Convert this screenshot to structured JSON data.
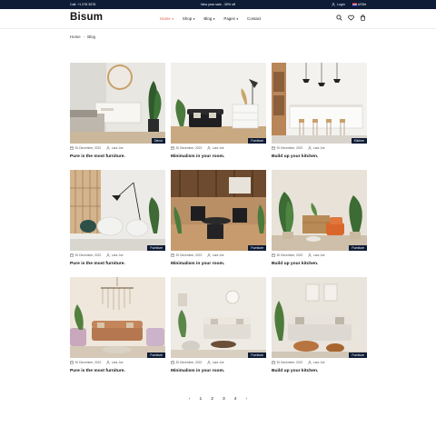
{
  "topbar": {
    "phone": "Call: +1 078 3578",
    "promo": "New year sale - 30% off",
    "login": "Login",
    "currency": "USD"
  },
  "header": {
    "logo": "Bisum",
    "nav": [
      {
        "label": "Home",
        "active": true
      },
      {
        "label": "Shop",
        "active": false
      },
      {
        "label": "Blog",
        "active": false
      },
      {
        "label": "Pages",
        "active": false
      },
      {
        "label": "Contact",
        "active": false
      }
    ],
    "icons": [
      "search-icon",
      "heart-icon",
      "cart-icon"
    ]
  },
  "breadcrumb": {
    "home": "Home",
    "current": "Blog"
  },
  "posts": [
    {
      "tag": "Décor",
      "date": "30 December, 2022",
      "author": "Lara Joe",
      "title": "Pure is the most furniture."
    },
    {
      "tag": "Furniture",
      "date": "30 December, 2022",
      "author": "Lara Joe",
      "title": "Minimalism in your room."
    },
    {
      "tag": "Kitchen",
      "date": "30 December, 2022",
      "author": "Lara Joe",
      "title": "Build up your kitchen."
    },
    {
      "tag": "Furniture",
      "date": "30 December, 2022",
      "author": "Lara Joe",
      "title": "Pure is the most furniture."
    },
    {
      "tag": "Furniture",
      "date": "30 December, 2022",
      "author": "Lara Joe",
      "title": "Minimalism in your room."
    },
    {
      "tag": "Furniture",
      "date": "30 December, 2022",
      "author": "Lara Joe",
      "title": "Build up your kitchen."
    },
    {
      "tag": "Furniture",
      "date": "30 December, 2022",
      "author": "Lara Joe",
      "title": "Pure is the most furniture."
    },
    {
      "tag": "Furniture",
      "date": "30 December, 2022",
      "author": "Lara Joe",
      "title": "Minimalism in your room."
    },
    {
      "tag": "Furniture",
      "date": "30 December, 2022",
      "author": "Lara Joe",
      "title": "Build up your kitchen."
    }
  ],
  "pagination": {
    "prev": "‹",
    "pages": [
      "1",
      "2",
      "3",
      "4"
    ],
    "next": "›"
  },
  "colors": {
    "dark": "#0e1c36",
    "accent": "#e55b4d"
  }
}
